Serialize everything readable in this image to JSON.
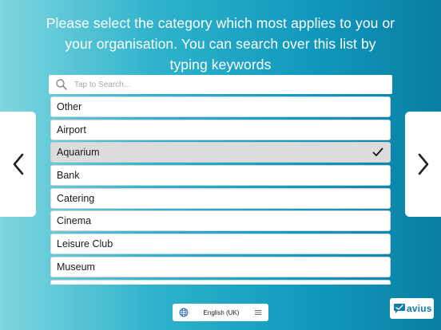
{
  "prompt": {
    "line1": "Please select the category which most applies to you or",
    "line2": "your organisation. You can search over this list by",
    "line3": "typing keywords"
  },
  "search": {
    "placeholder": "Tap to Search...",
    "value": "",
    "icon": "search-icon"
  },
  "categories": [
    {
      "label": "Other",
      "selected": false
    },
    {
      "label": "Airport",
      "selected": false
    },
    {
      "label": "Aquarium",
      "selected": true
    },
    {
      "label": "Bank",
      "selected": false
    },
    {
      "label": "Catering",
      "selected": false
    },
    {
      "label": "Cinema",
      "selected": false
    },
    {
      "label": "Leisure Club",
      "selected": false
    },
    {
      "label": "Museum",
      "selected": false
    },
    {
      "label": "",
      "selected": false
    }
  ],
  "navigation": {
    "previous_icon": "chevron-left-icon",
    "next_icon": "chevron-right-icon"
  },
  "language": {
    "selected": "English (UK)",
    "globe_icon": "globe-icon",
    "menu_icon": "menu-icon"
  },
  "brand": {
    "name": "avius"
  },
  "colors": {
    "accent": "#1199bd",
    "brand": "#0f7ea6",
    "selected_row": "#dcdcdc"
  }
}
